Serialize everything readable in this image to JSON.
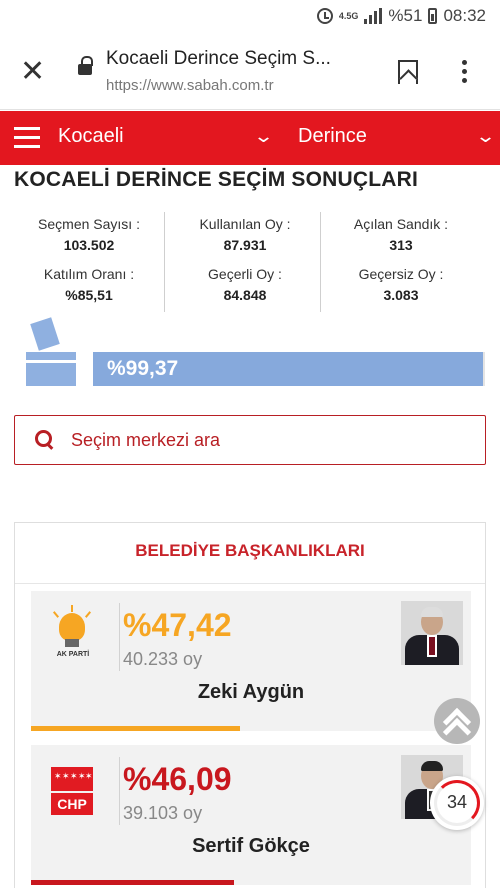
{
  "status_bar": {
    "network": "4.5G",
    "battery": "%51",
    "time": "08:32"
  },
  "browser": {
    "tab_title": "Kocaeli Derince Seçim S...",
    "url": "https://www.sabah.com.tr"
  },
  "nav": {
    "province": "Kocaeli",
    "district": "Derince"
  },
  "page_title": "KOCAELİ DERİNCE SEÇİM SONUÇLARI",
  "stats": {
    "voters_label": "Seçmen Sayısı :",
    "voters_value": "103.502",
    "used_votes_label": "Kullanılan Oy :",
    "used_votes_value": "87.931",
    "opened_boxes_label": "Açılan Sandık :",
    "opened_boxes_value": "313",
    "turnout_label": "Katılım Oranı :",
    "turnout_value": "%85,51",
    "valid_votes_label": "Geçerli Oy :",
    "valid_votes_value": "84.848",
    "invalid_votes_label": "Geçersiz Oy :",
    "invalid_votes_value": "3.083"
  },
  "progress": {
    "label": "%99,37",
    "fraction": 0.9937
  },
  "search": {
    "placeholder": "Seçim merkezi ara"
  },
  "results": {
    "section_title": "BELEDİYE BAŞKANLIKLARI",
    "candidates": [
      {
        "party_logo_text": "AK PARTİ",
        "percent": "%47,42",
        "votes": "40.233 oy",
        "name": "Zeki Aygün",
        "color": "#f6a623",
        "share": 0.4742
      },
      {
        "party_logo_text": "CHP",
        "percent": "%46,09",
        "votes": "39.103 oy",
        "name": "Sertif Gökçe",
        "color": "#c8171e",
        "share": 0.4609
      }
    ]
  },
  "widgets": {
    "counter": "34"
  },
  "colors": {
    "brand_red": "#e3171f",
    "progress_blue": "#86a9dc"
  }
}
